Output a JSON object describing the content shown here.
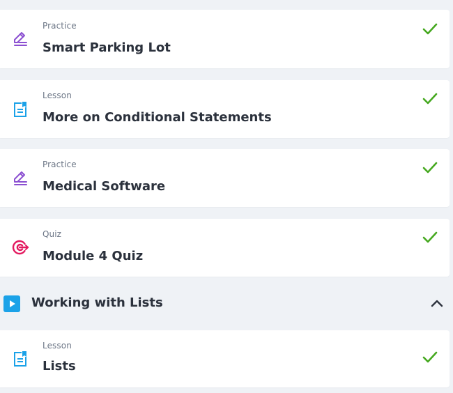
{
  "items": [
    {
      "type": "Practice",
      "title": "Smart Parking Lot",
      "icon": "pencil-edit-icon",
      "completed": true
    },
    {
      "type": "Lesson",
      "title": "More on Conditional Statements",
      "icon": "lesson-document-icon",
      "completed": true
    },
    {
      "type": "Practice",
      "title": "Medical Software",
      "icon": "pencil-edit-icon",
      "completed": true
    },
    {
      "type": "Quiz",
      "title": "Module 4 Quiz",
      "icon": "target-icon",
      "completed": true
    }
  ],
  "section": {
    "title": "Working with Lists",
    "icon": "play-icon",
    "expanded": true,
    "items": [
      {
        "type": "Lesson",
        "title": "Lists",
        "icon": "lesson-document-icon",
        "completed": true
      }
    ]
  },
  "colors": {
    "background": "#eff2f6",
    "practice_icon": "#8b4fd1",
    "lesson_icon": "#1ba2e8",
    "quiz_icon": "#e3195f",
    "check": "#45a81f",
    "section_icon": "#1ba2e8"
  }
}
